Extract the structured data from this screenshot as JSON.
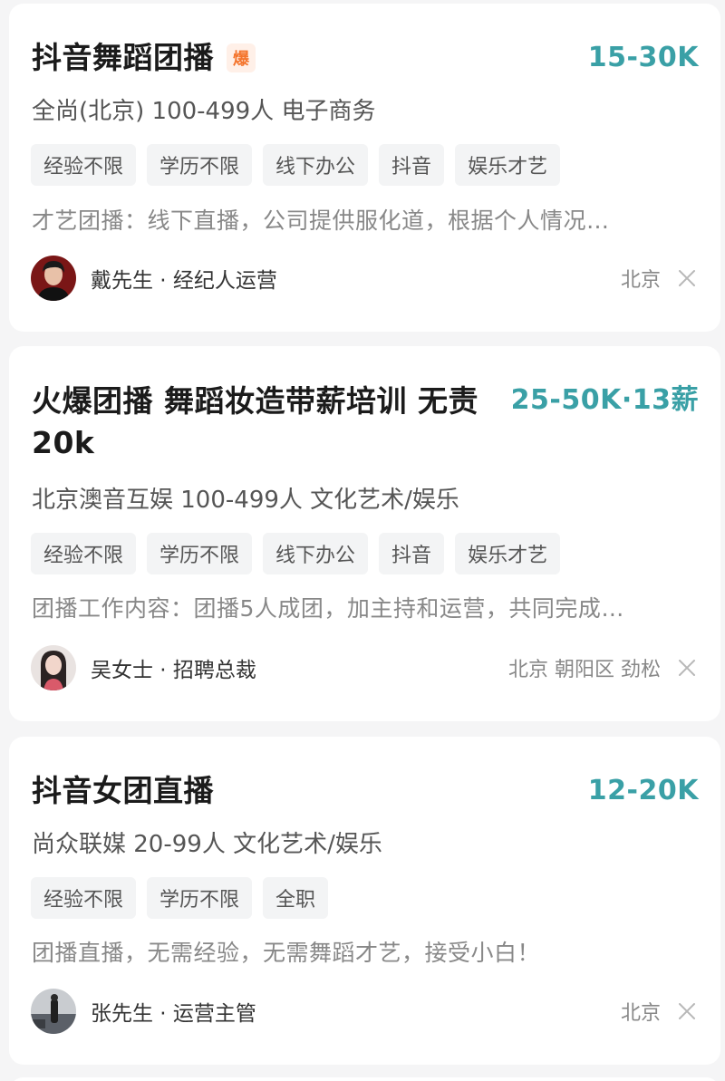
{
  "jobs": [
    {
      "title": "抖音舞蹈团播",
      "badge": "爆",
      "salary": "15-30K",
      "company": "全尚(北京) 100-499人 电子商务",
      "tags": [
        "经验不限",
        "学历不限",
        "线下办公",
        "抖音",
        "娱乐才艺"
      ],
      "description": "才艺团播：线下直播，公司提供服化道，根据个人情况…",
      "recruiter": "戴先生 · 经纪人运营",
      "location": "北京"
    },
    {
      "title": "火爆团播 舞蹈妆造带薪培训 无责20k",
      "salary": "25-50K·13薪",
      "company": "北京澳音互娱 100-499人 文化艺术/娱乐",
      "tags": [
        "经验不限",
        "学历不限",
        "线下办公",
        "抖音",
        "娱乐才艺"
      ],
      "description": "团播工作内容：团播5人成团，加主持和运营，共同完成…",
      "recruiter": "吴女士 · 招聘总裁",
      "location": "北京 朝阳区 劲松"
    },
    {
      "title": "抖音女团直播",
      "salary": "12-20K",
      "company": "尚众联媒 20-99人 文化艺术/娱乐",
      "tags": [
        "经验不限",
        "学历不限",
        "全职"
      ],
      "description": "团播直播，无需经验，无需舞蹈才艺，接受小白！",
      "recruiter": "张先生 · 运营主管",
      "location": "北京"
    }
  ],
  "colors": {
    "salary": "#3aa0a6",
    "badge_bg": "#fff0e8",
    "badge_text": "#f4742c",
    "background": "#f5f5f6"
  },
  "icons": {
    "close": "close-icon",
    "avatar": "avatar"
  }
}
